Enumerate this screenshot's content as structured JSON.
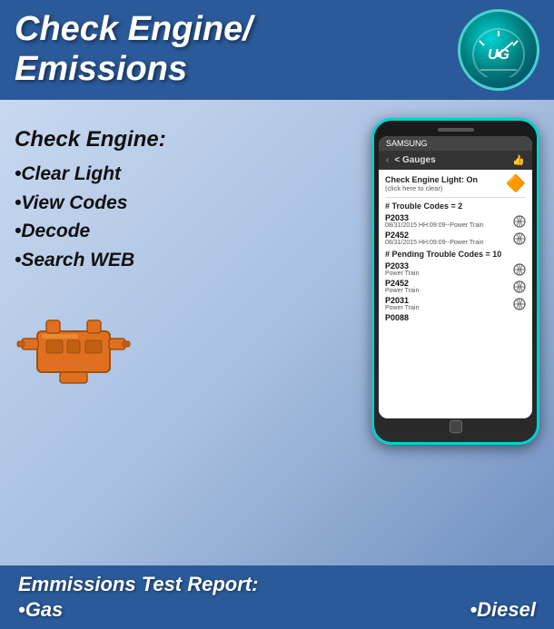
{
  "header": {
    "title_line1": "Check Engine/",
    "title_line2": "Emissions",
    "logo_alt": "UG Logo"
  },
  "left_panel": {
    "title": "Check Engine:",
    "items": [
      "•Clear Light",
      "•View Codes",
      "•Decode",
      "•Search WEB"
    ]
  },
  "phone": {
    "top_bar": "SAMSUNG",
    "nav": {
      "back": "< Gauges",
      "thumb": "👍"
    },
    "cel": {
      "label": "Check Engine Light: On",
      "sub": "(click here to clear)"
    },
    "trouble_codes_header": "# Trouble Codes = 2",
    "trouble_codes": [
      {
        "code": "P2033",
        "date": "08/31/2015 HH:09:09--Power Train"
      },
      {
        "code": "P2452",
        "date": "08/31/2015 HH:09:09--Power Train"
      }
    ],
    "pending_header": "# Pending Trouble Codes = 10",
    "pending_codes": [
      {
        "code": "P2033",
        "sub": "Power Train"
      },
      {
        "code": "P2452",
        "sub": "Power Train"
      },
      {
        "code": "P2031",
        "sub": "Power Train"
      },
      {
        "code": "P0088",
        "sub": ""
      }
    ]
  },
  "footer": {
    "title": "Emmissions Test Report:",
    "gas_label": "•Gas",
    "diesel_label": "•Diesel"
  }
}
